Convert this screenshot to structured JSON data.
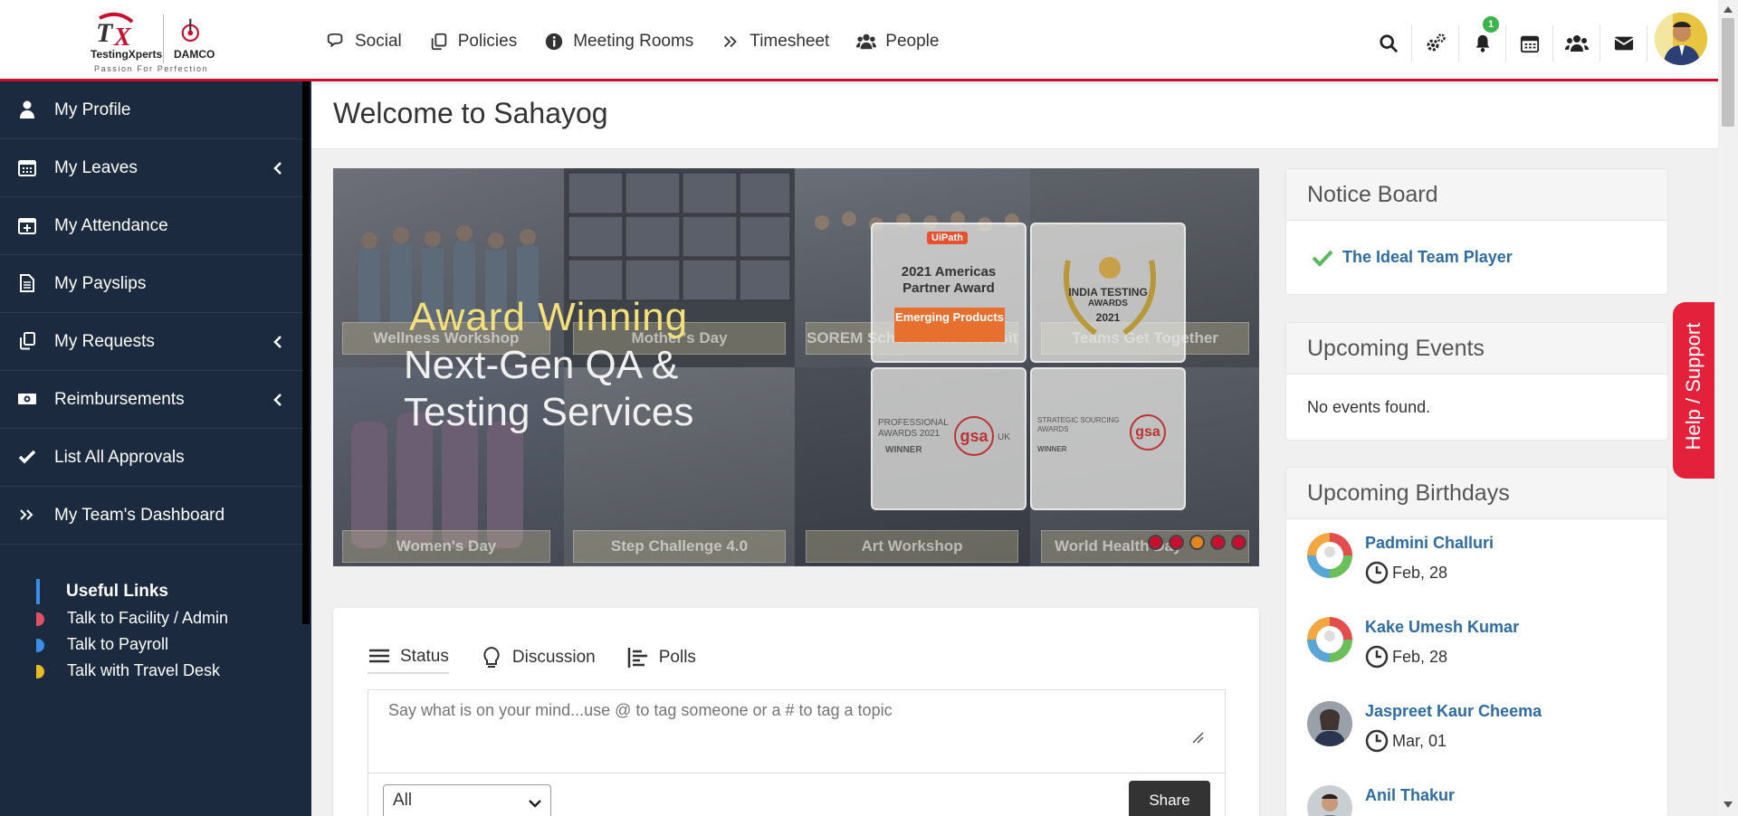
{
  "brand": {
    "logo1": "TestingXperts",
    "logo2": "DAMCO",
    "tagline": "Passion For Perfection"
  },
  "nav": [
    {
      "label": "Social",
      "icon": "comments-icon"
    },
    {
      "label": "Policies",
      "icon": "copy-icon"
    },
    {
      "label": "Meeting Rooms",
      "icon": "info-circle-icon"
    },
    {
      "label": "Timesheet",
      "icon": "double-chevron-right-icon"
    },
    {
      "label": "People",
      "icon": "users-icon"
    }
  ],
  "tools": {
    "notification_count": "1"
  },
  "sidebar": {
    "items": [
      {
        "label": "My Profile",
        "icon": "user-icon"
      },
      {
        "label": "My Leaves",
        "icon": "calendar-icon"
      },
      {
        "label": "My Attendance",
        "icon": "calendar-plus-icon"
      },
      {
        "label": "My Payslips",
        "icon": "document-icon"
      },
      {
        "label": "My Requests",
        "icon": "copy-icon"
      },
      {
        "label": "Reimbursements",
        "icon": "money-icon"
      },
      {
        "label": "List All Approvals",
        "icon": "check-icon"
      },
      {
        "label": "My Team's Dashboard",
        "icon": "double-chevron-right-icon"
      }
    ],
    "useful_links": {
      "title": "Useful Links",
      "links": [
        {
          "label": "Talk to Facility / Admin",
          "color": "#e05263"
        },
        {
          "label": "Talk to Payroll",
          "color": "#3a8ee6"
        },
        {
          "label": "Talk with Travel Desk",
          "color": "#e8b923"
        }
      ]
    }
  },
  "page": {
    "title": "Welcome to Sahayog"
  },
  "banner": {
    "headline1": "Award Winning",
    "headline2": "Next-Gen QA &",
    "headline3": "Testing Services",
    "tiles": [
      "Wellness Workshop",
      "Mother's Day",
      "SOREM School children visit",
      "Teams Get Together",
      "Women's Day",
      "Step Challenge 4.0",
      "Art Workshop",
      "World Health Day"
    ],
    "awards": {
      "a1_brand": "UiPath",
      "a1_line1": "2021 Americas",
      "a1_line2": "Partner Award",
      "a1_tag": "Emerging Products",
      "a2_line1": "INDIA TESTING",
      "a2_line2": "AWARDS",
      "a2_year": "2021",
      "a3_line1": "PROFESSIONAL",
      "a3_line2": "AWARDS 2021",
      "a3_line3": "WINNER",
      "a3_logo": "gsa",
      "a3_uk": "UK",
      "a4_line1": "STRATEGIC SOURCING",
      "a4_line2": "AWARDS",
      "a4_line3": "WINNER",
      "a4_logo": "gsa"
    }
  },
  "post": {
    "tabs": [
      {
        "label": "Status",
        "icon": "bars-icon"
      },
      {
        "label": "Discussion",
        "icon": "lightbulb-icon"
      },
      {
        "label": "Polls",
        "icon": "poll-icon"
      }
    ],
    "placeholder": "Say what is on your mind...use @ to tag someone or a # to tag a topic",
    "audience": "All",
    "share_label": "Share"
  },
  "notice_board": {
    "title": "Notice Board",
    "items": [
      "The Ideal Team Player"
    ]
  },
  "events": {
    "title": "Upcoming Events",
    "empty": "No events found."
  },
  "birthdays": {
    "title": "Upcoming Birthdays",
    "people": [
      {
        "name": "Padmini Challuri",
        "date": "Feb, 28"
      },
      {
        "name": "Kake Umesh Kumar",
        "date": "Feb, 28"
      },
      {
        "name": "Jaspreet Kaur Cheema",
        "date": "Mar, 01"
      },
      {
        "name": "Anil Thakur",
        "date": ""
      }
    ]
  },
  "help": {
    "label": "Help / Support"
  }
}
